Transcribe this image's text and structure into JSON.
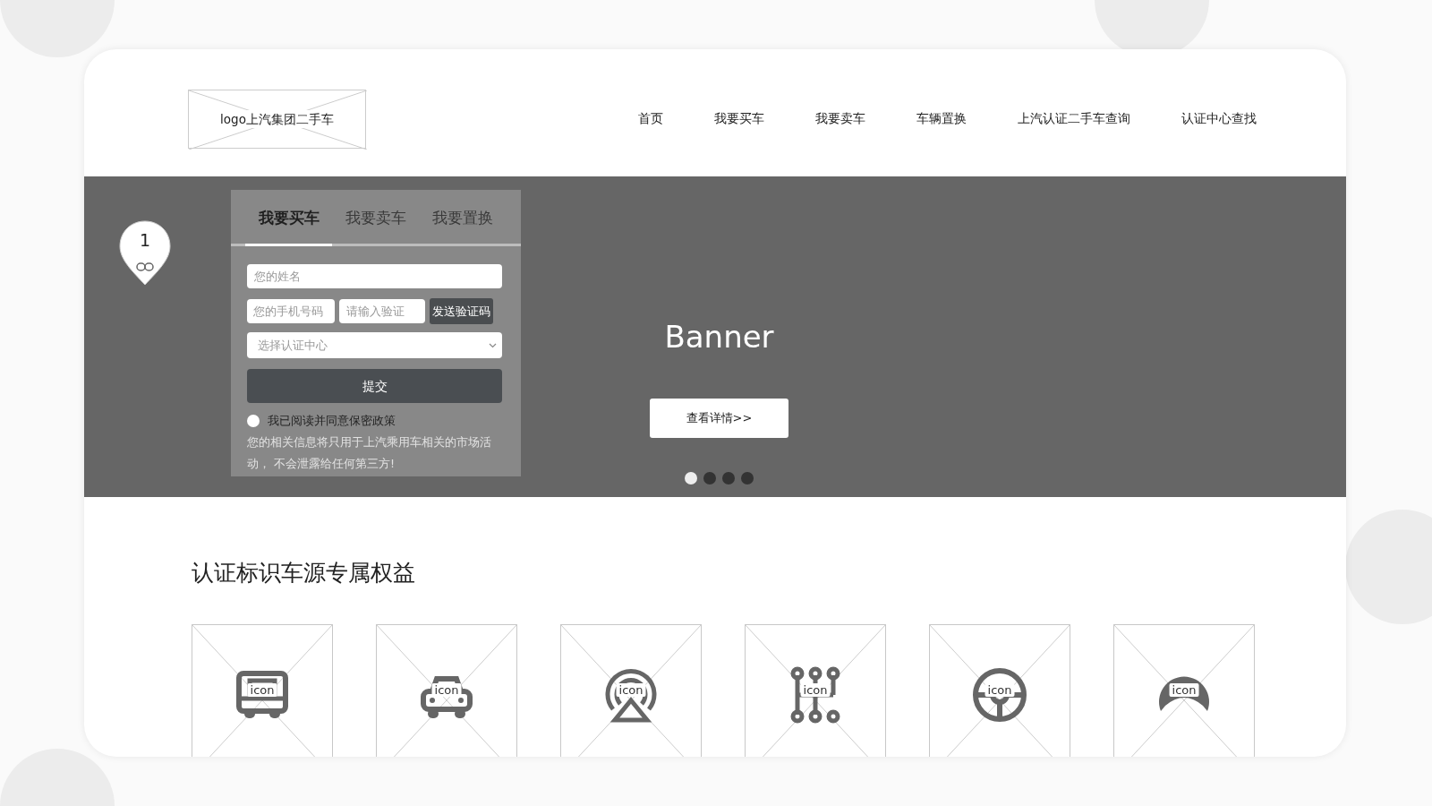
{
  "header": {
    "logo": "logo上汽集团二手车",
    "nav": [
      {
        "label": "首页"
      },
      {
        "label": "我要买车"
      },
      {
        "label": "我要卖车"
      },
      {
        "label": "车辆置换"
      },
      {
        "label": "上汽认证二手车查询"
      },
      {
        "label": "认证中心查找"
      }
    ]
  },
  "banner": {
    "marker": "1",
    "form": {
      "tabs": [
        {
          "label": "我要买车",
          "selected": true
        },
        {
          "label": "我要卖车",
          "selected": false
        },
        {
          "label": "我要置换",
          "selected": false
        }
      ],
      "name": {
        "placeholder": "您的姓名"
      },
      "phone": {
        "placeholder": "您的手机号码"
      },
      "code": {
        "placeholder": "请输入验证"
      },
      "send_button": "发送验证码",
      "center": {
        "placeholder": "选择认证中心"
      },
      "submit": "提交",
      "agree": {
        "label": "我已阅读并同意保密政策",
        "checked": false
      },
      "note": "您的相关信息将只用于上汽乘用车相关的市场活动， 不会泄露给任何第三方!"
    },
    "title": "Banner",
    "button": "查看详情>>",
    "dots": [
      {
        "selected": true
      },
      {
        "selected": false
      },
      {
        "selected": false
      },
      {
        "selected": false
      }
    ]
  },
  "benefits": {
    "title": "认证标识车源专属权益",
    "cards": [
      {
        "label": "icon"
      },
      {
        "label": "icon"
      },
      {
        "label": "icon"
      },
      {
        "label": "icon"
      },
      {
        "label": "icon"
      },
      {
        "label": "icon"
      }
    ]
  }
}
